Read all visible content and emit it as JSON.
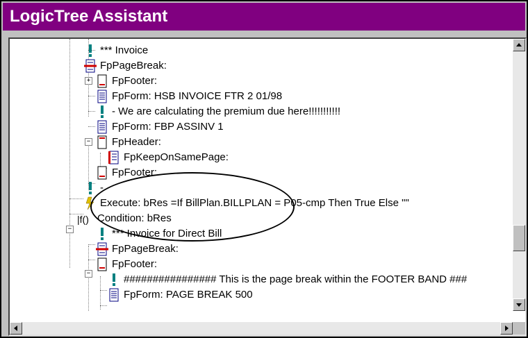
{
  "window": {
    "title": "LogicTree Assistant"
  },
  "tree": {
    "nodes": [
      {
        "label": "***      Invoice",
        "icon": "exclamation-icon"
      },
      {
        "label": "FpPageBreak:",
        "icon": "page-break-icon"
      },
      {
        "label": "FpFooter:",
        "icon": "footer-document-icon",
        "expander": "+"
      },
      {
        "label": "FpForm: HSB INVOICE FTR 2 01/98",
        "icon": "form-document-icon"
      },
      {
        "label": "- We are calculating the premium due here!!!!!!!!!!!",
        "icon": "exclamation-icon"
      },
      {
        "label": "FpForm: FBP ASSINV 1",
        "icon": "form-document-icon"
      },
      {
        "label": "FpHeader:",
        "icon": "header-document-icon",
        "expander": "−"
      },
      {
        "label": "FpKeepOnSamePage:",
        "icon": "keep-on-same-page-icon"
      },
      {
        "label": "FpFooter:",
        "icon": "footer-document-icon"
      },
      {
        "label": "-",
        "icon": "exclamation-icon"
      },
      {
        "label": "Execute: bRes =If BillPlan.BILLPLAN = P05-cmp Then True Else \"\"",
        "icon": "lightning-icon"
      },
      {
        "label": "Condition: bRes",
        "icon": "condition-icon",
        "expander": "−"
      },
      {
        "label": "***      Invoice for Direct Bill",
        "icon": "exclamation-icon"
      },
      {
        "label": "FpPageBreak:",
        "icon": "page-break-icon"
      },
      {
        "label": "FpFooter:",
        "icon": "footer-document-icon",
        "expander": "−"
      },
      {
        "label": "################ This is the page break within the FOOTER BAND ###",
        "icon": "exclamation-icon"
      },
      {
        "label": "FpForm: PAGE BREAK 500",
        "icon": "form-document-icon"
      }
    ]
  },
  "scroll": {
    "vertical_position": 0.78,
    "horizontal_position": 0.0
  },
  "colors": {
    "titlebar": "#800080",
    "exclamation": "#008080",
    "document_red": "#d00000",
    "document_blue": "#000080",
    "lightning": "#e0c000"
  }
}
